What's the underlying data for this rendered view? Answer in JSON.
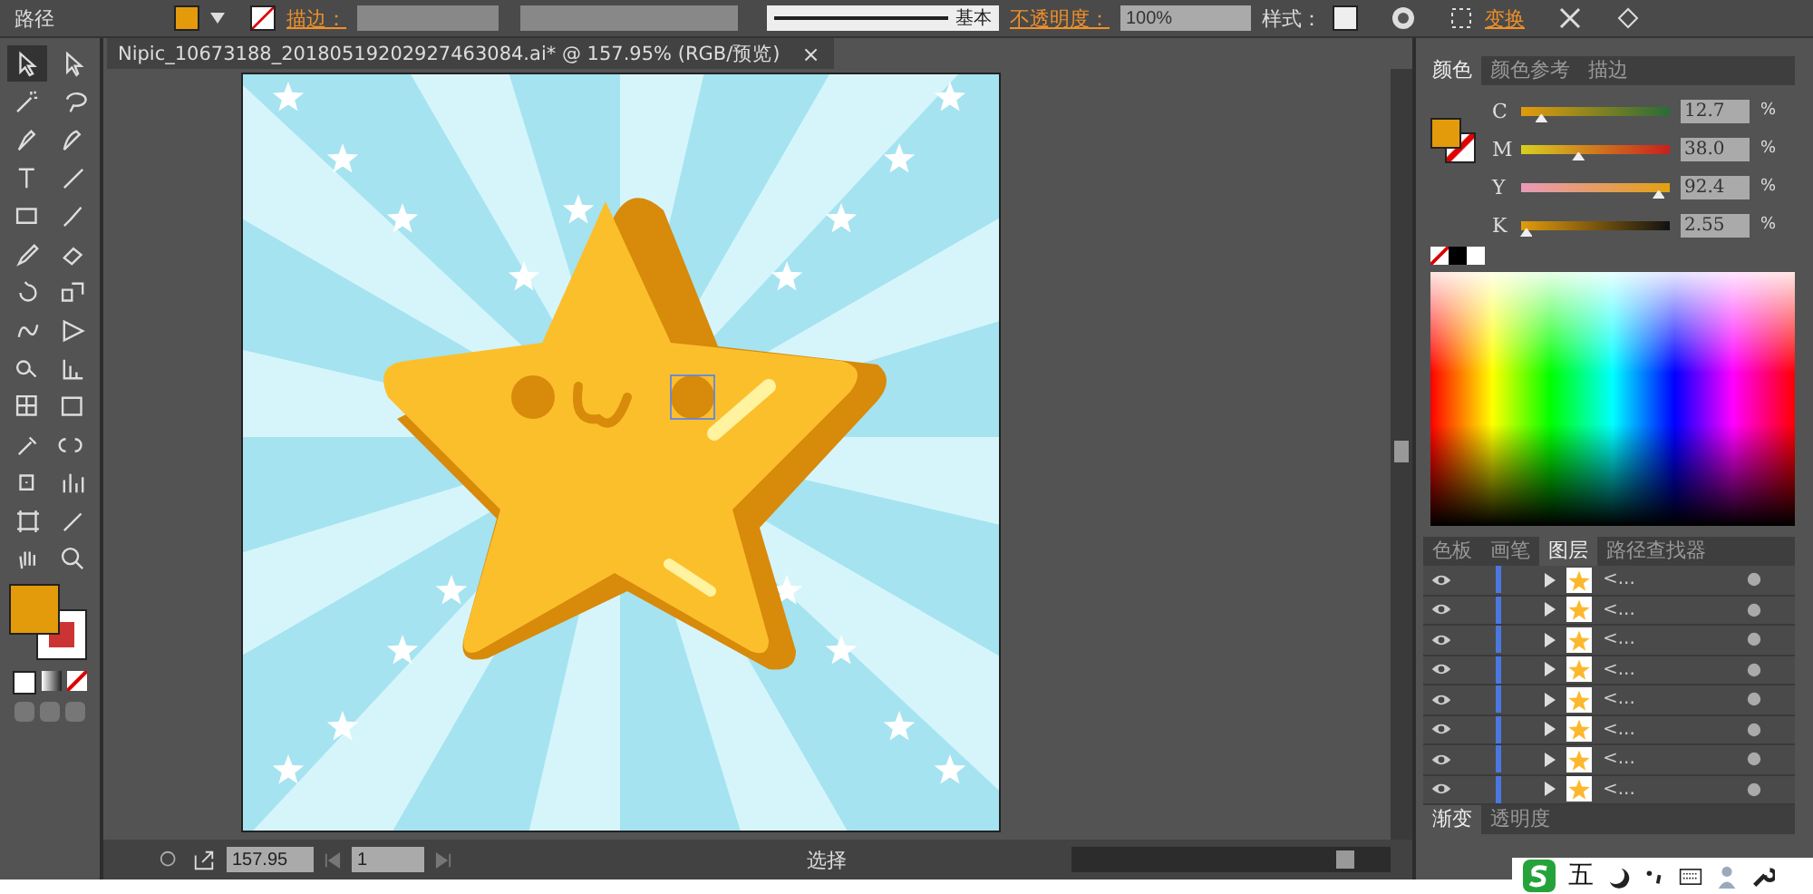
{
  "control_bar": {
    "object_type": "路径",
    "stroke_label": "描边：",
    "stroke_style": "基本",
    "opacity_label": "不透明度：",
    "opacity_value": "100%",
    "style_label": "样式：",
    "transform_link": "变换"
  },
  "document_tab": {
    "title": "Nipic_10673188_20180519202927463084.ai* @ 157.95% (RGB/预览)",
    "close": "×"
  },
  "color_panel": {
    "tabs": [
      {
        "label": "颜色",
        "selected": true
      },
      {
        "label": "颜色参考",
        "selected": false
      },
      {
        "label": "描边",
        "selected": false
      }
    ],
    "sliders": [
      {
        "channel": "C",
        "level": 0.13,
        "value": "12.7"
      },
      {
        "channel": "M",
        "level": 0.38,
        "value": "38.0"
      },
      {
        "channel": "Y",
        "level": 0.92,
        "value": "92.4"
      },
      {
        "channel": "K",
        "level": 0.03,
        "value": "2.55"
      }
    ],
    "unit": "%"
  },
  "layers_panel": {
    "tabs": [
      {
        "label": "色板",
        "selected": false
      },
      {
        "label": "画笔",
        "selected": false
      },
      {
        "label": "图层",
        "selected": true
      },
      {
        "label": "路径查找器",
        "selected": false
      }
    ],
    "rows": [
      {
        "name": "<..."
      },
      {
        "name": "<..."
      },
      {
        "name": "<..."
      },
      {
        "name": "<..."
      },
      {
        "name": "<..."
      },
      {
        "name": "<..."
      },
      {
        "name": "<..."
      },
      {
        "name": "<..."
      }
    ]
  },
  "bottom_panel": {
    "tabs": [
      {
        "label": "渐变",
        "selected": true
      },
      {
        "label": "透明度",
        "selected": false
      }
    ]
  },
  "status_bar": {
    "zoom": "157.95",
    "artboard": "1",
    "tool": "选择"
  },
  "ime_bar": {
    "mode": "五"
  }
}
